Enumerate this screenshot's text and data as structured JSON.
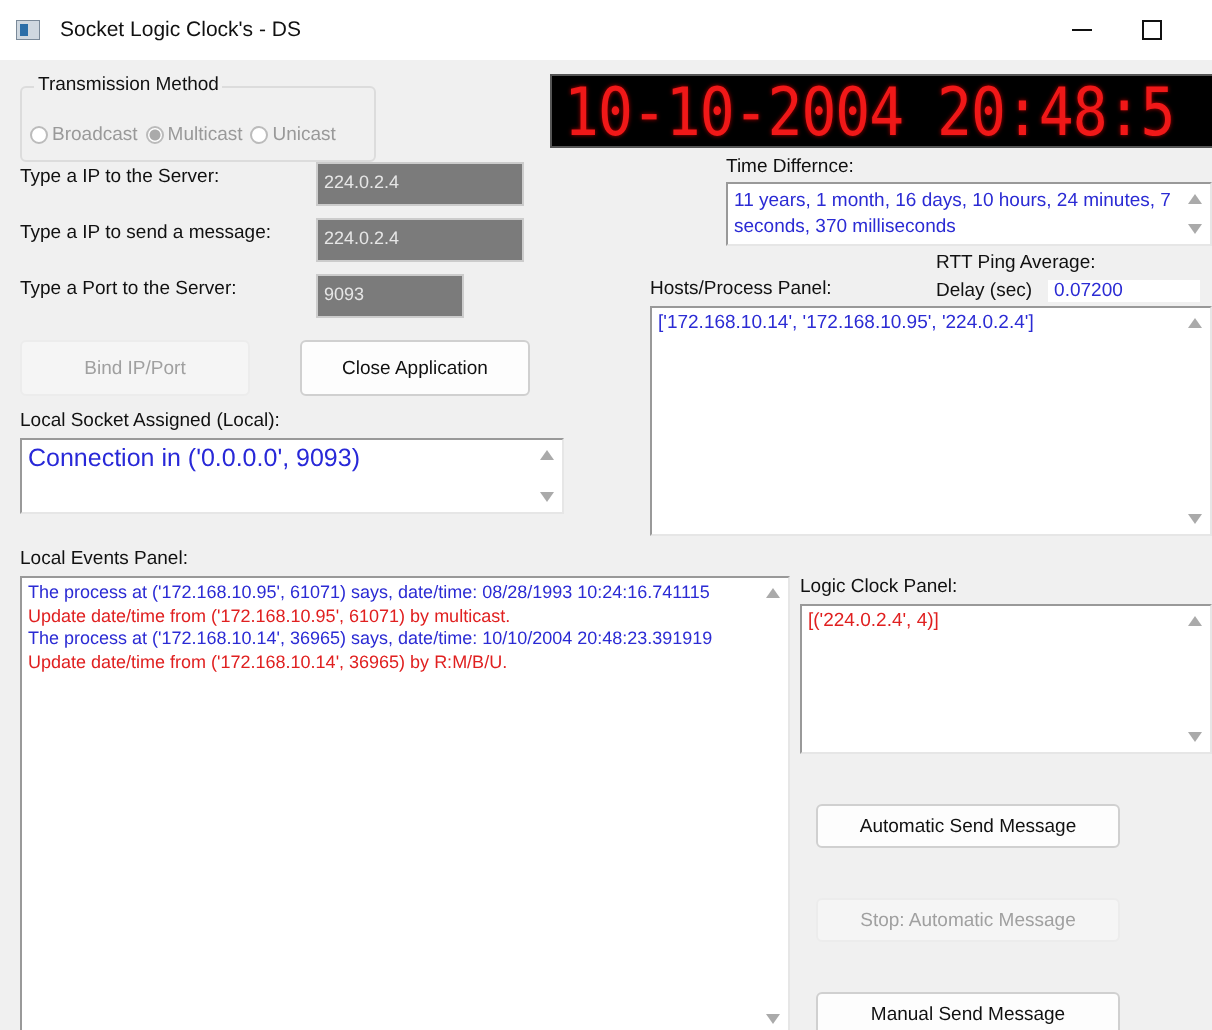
{
  "window": {
    "title": "Socket Logic Clock's - DS"
  },
  "transmission": {
    "title": "Transmission Method",
    "disabled": true,
    "options": [
      {
        "label": "Broadcast",
        "selected": false
      },
      {
        "label": "Multicast",
        "selected": true
      },
      {
        "label": "Unicast",
        "selected": false
      }
    ]
  },
  "clock_display": "10-10-2004 20:48:5",
  "fields": [
    {
      "label": "Type a IP to the Server:",
      "value": "224.0.2.4"
    },
    {
      "label": "Type a IP to send a message:",
      "value": "224.0.2.4"
    },
    {
      "label": "Type a Port to the Server:",
      "value": "9093"
    }
  ],
  "time_difference": {
    "label": "Time Differnce:",
    "text": "11 years, 1 month, 16 days, 10 hours, 24 minutes, 7 seconds, 370 milliseconds"
  },
  "rtt": {
    "title": "RTT Ping Average:",
    "label": "Delay (sec)",
    "value": "0.07200"
  },
  "hosts": {
    "label": "Hosts/Process Panel:",
    "text": "['172.168.10.14', '172.168.10.95', '224.0.2.4']"
  },
  "top_buttons": [
    {
      "label": "Bind IP/Port",
      "disabled": true
    },
    {
      "label": "Close Application",
      "disabled": false
    }
  ],
  "local_socket": {
    "label": "Local Socket Assigned (Local):",
    "text": "Connection in ('0.0.0.0', 9093)"
  },
  "events": {
    "label": "Local Events Panel:",
    "lines": [
      {
        "text": "The process at ('172.168.10.95', 61071) says, date/time: 08/28/1993 10:24:16.741115",
        "color": "#2b2bd4"
      },
      {
        "text": "Update date/time from ('172.168.10.95', 61071) by multicast.",
        "color": "#e02020"
      },
      {
        "text": "The process at ('172.168.10.14', 36965) says, date/time: 10/10/2004 20:48:23.391919",
        "color": "#2b2bd4"
      },
      {
        "text": "Update date/time from ('172.168.10.14', 36965) by R:M/B/U.",
        "color": "#e02020"
      }
    ]
  },
  "logic_clock": {
    "label": "Logic Clock Panel:",
    "text": "[('224.0.2.4', 4)]"
  },
  "side_buttons": [
    {
      "label": "Automatic Send Message",
      "disabled": false
    },
    {
      "label": "Stop: Automatic Message",
      "disabled": true
    },
    {
      "label": "Manual Send Message",
      "disabled": false
    }
  ]
}
